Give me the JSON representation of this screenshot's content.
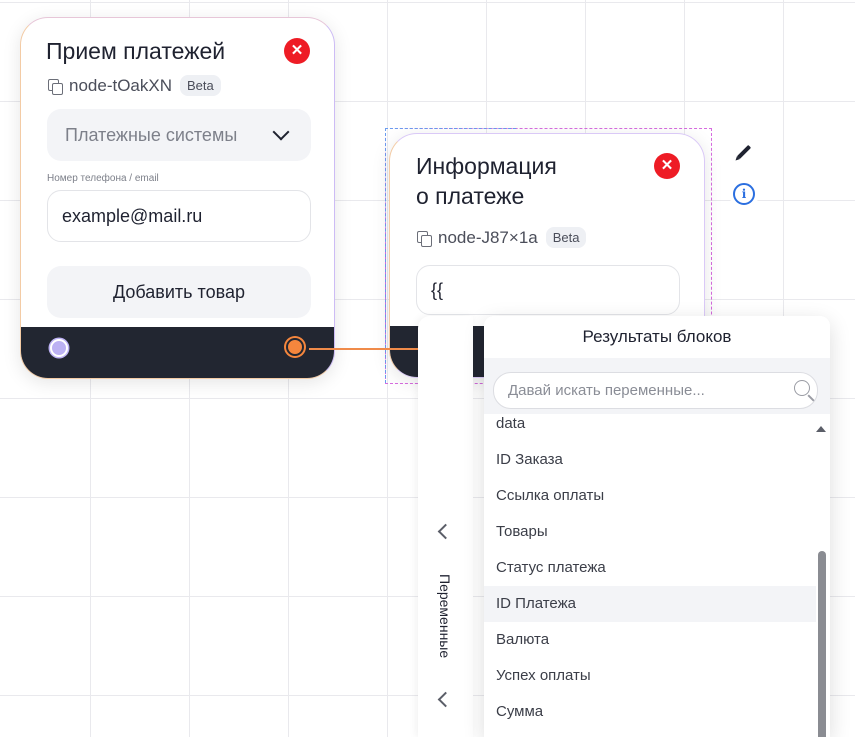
{
  "node_payment": {
    "title": "Прием платежей",
    "id": "node-tOakXN",
    "badge": "Beta",
    "select_value": "Платежные системы",
    "field_label": "Номер телефона / email",
    "field_value": "example@mail.ru",
    "add_button": "Добавить товар"
  },
  "node_info": {
    "title_line1": "Информация",
    "title_line2": "о платеже",
    "id": "node-J87×1a",
    "badge": "Beta",
    "input_value": "{{"
  },
  "variables_panel": {
    "label": "Переменные"
  },
  "results": {
    "title": "Результаты блоков",
    "search_placeholder": "Давай искать переменные...",
    "items": [
      "data",
      "ID Заказа",
      "Ссылка оплаты",
      "Товары",
      "Статус платежа",
      "ID Платежа",
      "Валюта",
      "Успех оплаты",
      "Сумма"
    ],
    "active_item": "ID Платежа"
  },
  "colors": {
    "close": "#ee1c25",
    "port_out": "#f5863d",
    "port_in": "#bcb1f3",
    "footer": "#222631",
    "connector": "#f08b4a"
  },
  "icons": [
    "close-icon",
    "copy-icon",
    "chevron-down-icon",
    "pencil-icon",
    "info-icon",
    "search-icon",
    "chevron-left-icon"
  ]
}
